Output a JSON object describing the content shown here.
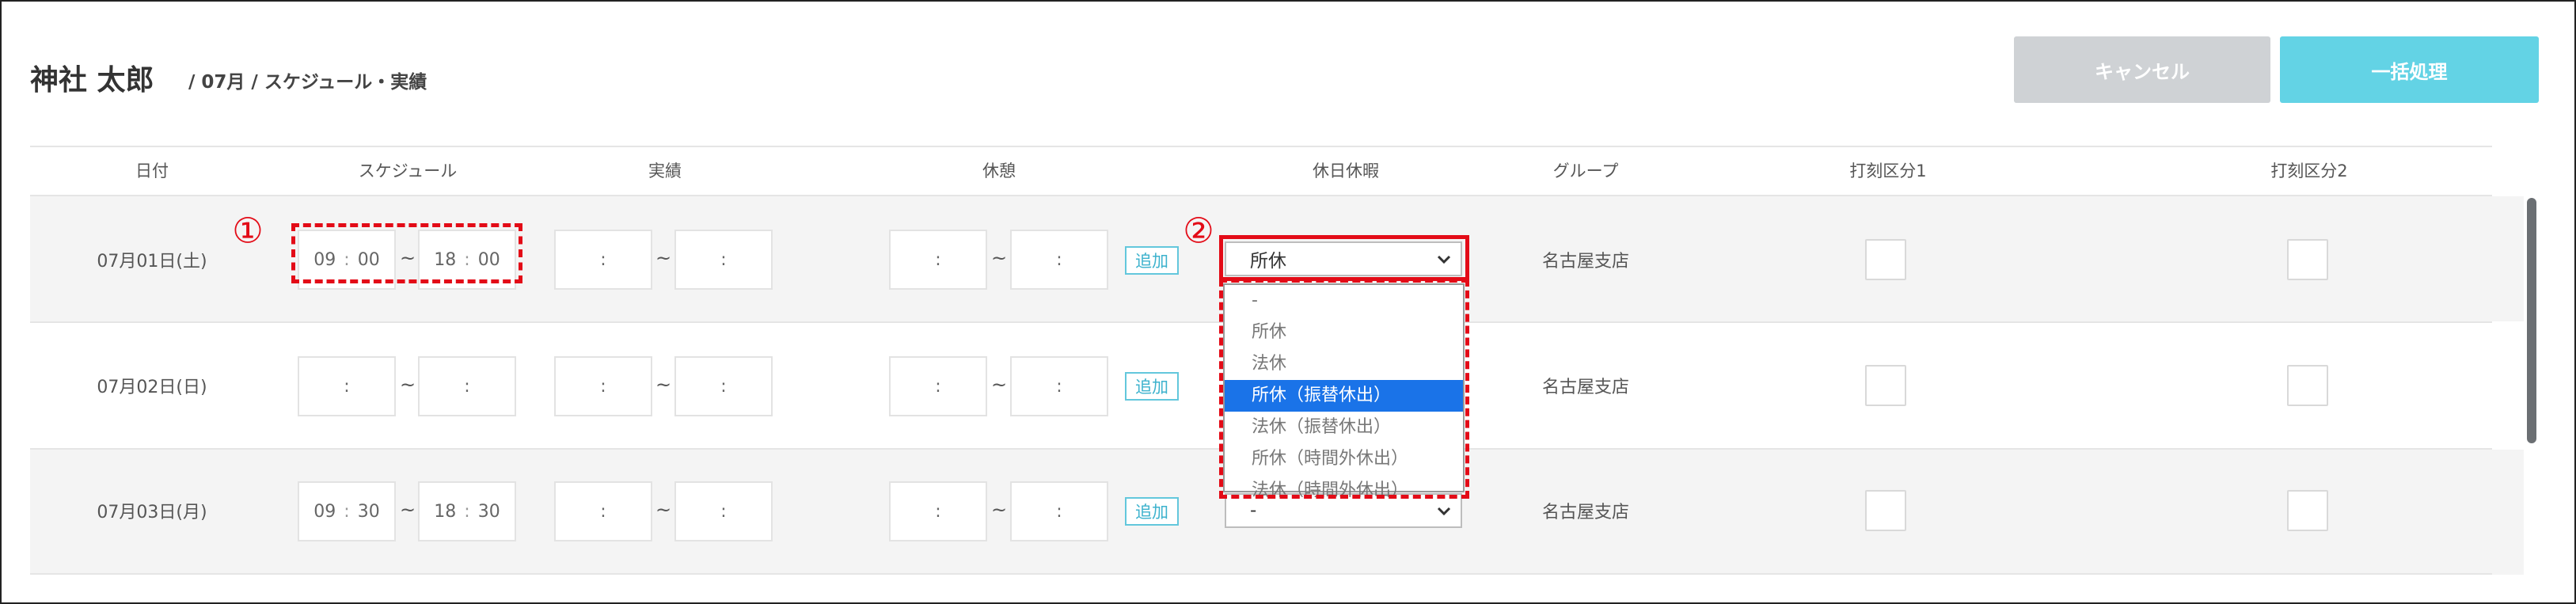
{
  "page": {
    "name": "神社 太郎",
    "subtitle": "/ 07月 / スケジュール・実績"
  },
  "actions": {
    "cancel": "キャンセル",
    "bulk": "一括処理"
  },
  "headers": [
    "日付",
    "スケジュール",
    "実績",
    "休憩",
    "休日休暇",
    "グループ",
    "打刻区分1",
    "打刻区分2"
  ],
  "rows": [
    {
      "date": "07月01日(土)",
      "sched_start_h": "09",
      "sched_start_m": "00",
      "sched_end_h": "18",
      "sched_end_m": "00",
      "holiday": "所休",
      "group": "名古屋支店",
      "add": "追加"
    },
    {
      "date": "07月02日(日)",
      "sched_start_h": "",
      "sched_start_m": "",
      "sched_end_h": "",
      "sched_end_m": "",
      "holiday": "",
      "group": "名古屋支店",
      "add": "追加"
    },
    {
      "date": "07月03日(月)",
      "sched_start_h": "09",
      "sched_start_m": "30",
      "sched_end_h": "18",
      "sched_end_m": "30",
      "holiday": "-",
      "group": "名古屋支店",
      "add": "追加"
    }
  ],
  "time_separator": "~",
  "colon": ":",
  "dropdown_options": [
    "-",
    "所休",
    "法休",
    "所休（振替休出）",
    "法休（振替休出）",
    "所休（時間外休出）",
    "法休（時間外休出）"
  ],
  "dropdown_highlighted": "所休（振替休出）",
  "markers": {
    "one": "①",
    "two": "②"
  },
  "colors": {
    "accent": "#63d3e5",
    "annotation": "#e30b17",
    "highlight": "#1a73e8"
  }
}
